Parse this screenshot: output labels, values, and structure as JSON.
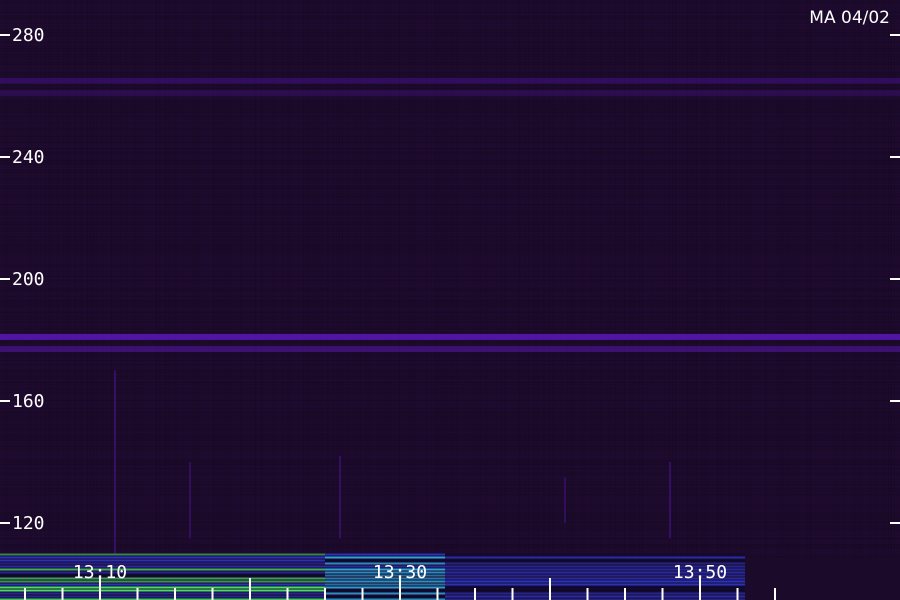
{
  "stamp": "MA 04/02",
  "colors": {
    "background": "#1c0a2a",
    "band": "#5a18b8",
    "hot": "#48e86a",
    "warm": "#2aa8e0",
    "cool": "#2a36c8",
    "axis": "#ffffff"
  },
  "chart_data": {
    "type": "heatmap",
    "title": "",
    "xlabel": "",
    "ylabel": "",
    "ylim": [
      105,
      290
    ],
    "y_ticks": [
      280,
      240,
      200,
      160,
      120
    ],
    "y_tick_labels": [
      "280",
      "240",
      "200",
      "160",
      "120"
    ],
    "x_time_range": [
      "13:03",
      "13:53"
    ],
    "x_major_ticks": [
      "13:10",
      "13:20",
      "13:30",
      "13:40",
      "13:50"
    ],
    "x_tick_labels": [
      "13:10",
      "13:30",
      "13:50"
    ],
    "x_minor_step_minutes": 2.5,
    "horizontal_bands": [
      {
        "value": 265,
        "intensity": 0.35
      },
      {
        "value": 261,
        "intensity": 0.25
      },
      {
        "value": 181,
        "intensity": 0.85
      },
      {
        "value": 177,
        "intensity": 0.5
      }
    ],
    "vertical_streaks": [
      {
        "time": "13:11",
        "from": 110,
        "to": 170,
        "intensity": 0.4
      },
      {
        "time": "13:16",
        "from": 115,
        "to": 140,
        "intensity": 0.35
      },
      {
        "time": "13:26",
        "from": 115,
        "to": 142,
        "intensity": 0.4
      },
      {
        "time": "13:41",
        "from": 120,
        "to": 135,
        "intensity": 0.35
      },
      {
        "time": "13:48",
        "from": 115,
        "to": 140,
        "intensity": 0.4
      }
    ],
    "low_band": {
      "from": 105,
      "to": 110,
      "segments": [
        {
          "from_time": "13:03",
          "to_time": "13:25",
          "level": "hot"
        },
        {
          "from_time": "13:25",
          "to_time": "13:33",
          "level": "warm"
        },
        {
          "from_time": "13:33",
          "to_time": "13:53",
          "level": "cool"
        }
      ]
    }
  }
}
